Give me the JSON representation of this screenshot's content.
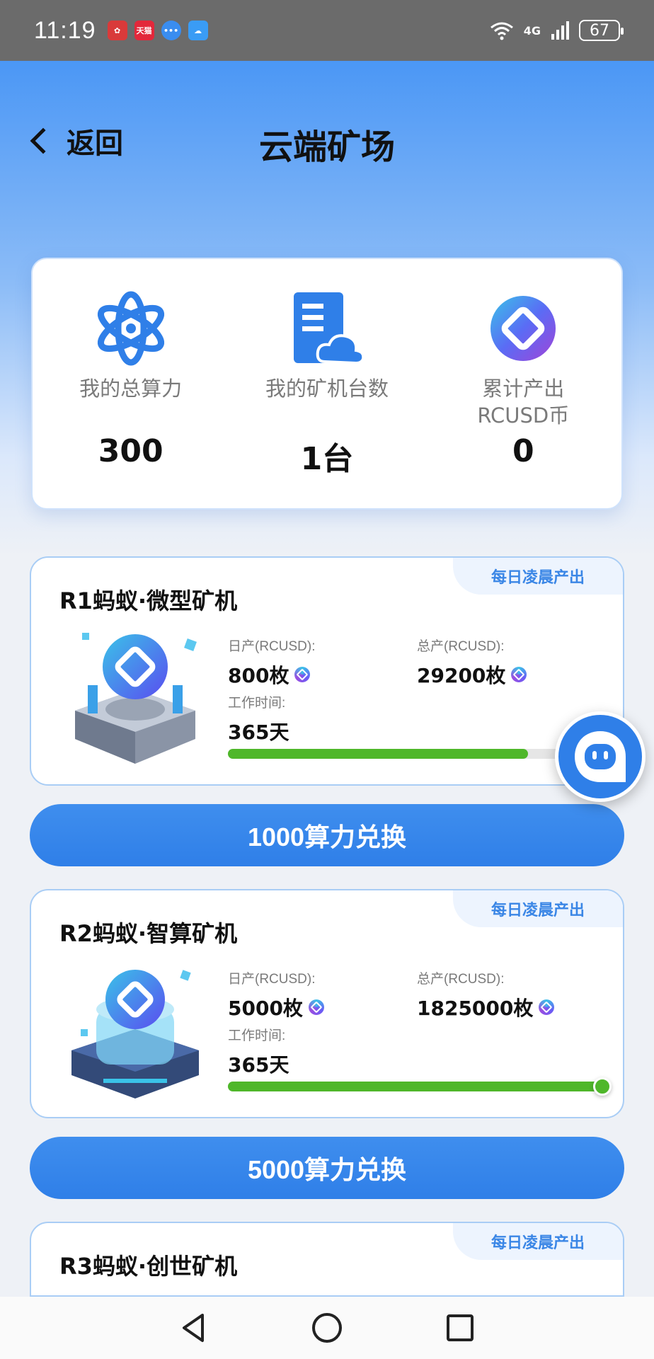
{
  "status_bar": {
    "time": "11:19",
    "notifications": [
      {
        "icon": "huawei-icon",
        "color": "#d93a3a"
      },
      {
        "icon": "tmall-icon",
        "label": "天猫",
        "color": "#e3283b"
      },
      {
        "icon": "chat-bubble-icon",
        "color": "#3a8df0"
      },
      {
        "icon": "weather-icon",
        "color": "#3a9cf5"
      }
    ],
    "network": "4G",
    "battery": "67"
  },
  "header": {
    "back_label": "返回",
    "title": "云端矿场"
  },
  "stats": [
    {
      "icon": "atom-icon",
      "label": "我的总算力",
      "value": "300"
    },
    {
      "icon": "server-cloud-icon",
      "label": "我的矿机台数",
      "value": "1台"
    },
    {
      "icon": "rcusd-coin-icon",
      "label": "累计产出\nRCUSD币",
      "value": "0"
    }
  ],
  "miners": [
    {
      "tag": "每日凌晨产出",
      "name": "R1蚂蚁·微型矿机",
      "daily_label": "日产(RCUSD):",
      "daily_value": "800枚",
      "total_label": "总产(RCUSD):",
      "total_value": "29200枚",
      "worktime_label": "工作时间:",
      "worktime_value": "365天",
      "progress": 0.8,
      "button_label": "1000算力兑换"
    },
    {
      "tag": "每日凌晨产出",
      "name": "R2蚂蚁·智算矿机",
      "daily_label": "日产(RCUSD):",
      "daily_value": "5000枚",
      "total_label": "总产(RCUSD):",
      "total_value": "1825000枚",
      "worktime_label": "工作时间:",
      "worktime_value": "365天",
      "progress": 1.0,
      "button_label": "5000算力兑换"
    },
    {
      "tag": "每日凌晨产出",
      "name": "R3蚂蚁·创世矿机"
    }
  ],
  "colors": {
    "accent": "#2f7fe8",
    "progress": "#4fb72a",
    "tag_text": "#3a86e6"
  },
  "nav": [
    "back-triangle-icon",
    "home-circle-icon",
    "recents-square-icon"
  ]
}
